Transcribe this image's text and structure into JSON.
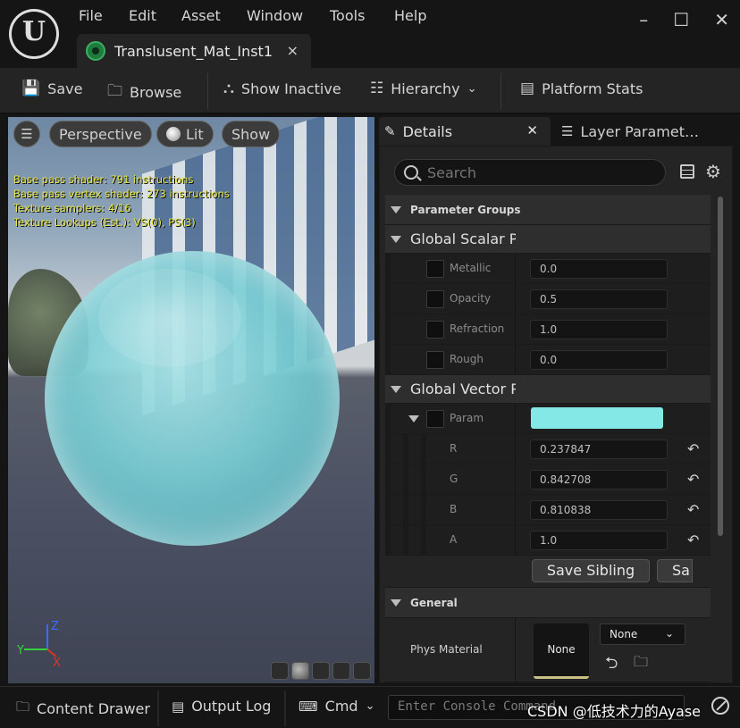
{
  "app": {
    "menu": [
      "File",
      "Edit",
      "Asset",
      "Window",
      "Tools",
      "Help"
    ],
    "window_controls": [
      "–",
      "☐",
      "✕"
    ],
    "document_tab": {
      "label": "Translusent_Mat_Inst1",
      "close": "×"
    }
  },
  "toolbar": {
    "save": "Save",
    "browse": "Browse",
    "show_inactive": "Show Inactive",
    "hierarchy": "Hierarchy",
    "platform_stats": "Platform Stats"
  },
  "viewport": {
    "perspective": "Perspective",
    "lit": "Lit",
    "show": "Show",
    "stats": [
      "Base pass shader: 791 instructions",
      "Base pass vertex shader: 273 instructions",
      "Texture samplers: 4/16",
      "Texture Lookups (Est.): VS(0), PS(3)"
    ],
    "axes": {
      "z": "Z",
      "y": "Y",
      "x": "X"
    }
  },
  "panel_tabs": {
    "details": "Details",
    "layer_parameters": "Layer Paramet…"
  },
  "details": {
    "search_placeholder": "Search",
    "parameter_groups": "Parameter Groups",
    "global_scalar": {
      "title": "Global Scalar Pa",
      "params": [
        {
          "label": "Metallic",
          "value": "0.0"
        },
        {
          "label": "Opacity",
          "value": "0.5"
        },
        {
          "label": "Refraction",
          "value": "1.0"
        },
        {
          "label": "Rough",
          "value": "0.0"
        }
      ]
    },
    "global_vector": {
      "title": "Global Vector P",
      "param_label": "Param",
      "swatch_color": "#84e9e6",
      "channels": [
        {
          "label": "R",
          "value": "0.237847"
        },
        {
          "label": "G",
          "value": "0.842708"
        },
        {
          "label": "B",
          "value": "0.810838"
        },
        {
          "label": "A",
          "value": "1.0"
        }
      ],
      "save_sibling": "Save Sibling",
      "save_child": "Sa"
    },
    "general": {
      "title": "General",
      "phys_material_label": "Phys Material",
      "phys_thumb": "None",
      "phys_select": "None"
    }
  },
  "statusbar": {
    "content_drawer": "Content Drawer",
    "output_log": "Output Log",
    "cmd": "Cmd",
    "console_placeholder": "Enter Console Command",
    "watermark": "CSDN @低技术力的Ayase"
  }
}
